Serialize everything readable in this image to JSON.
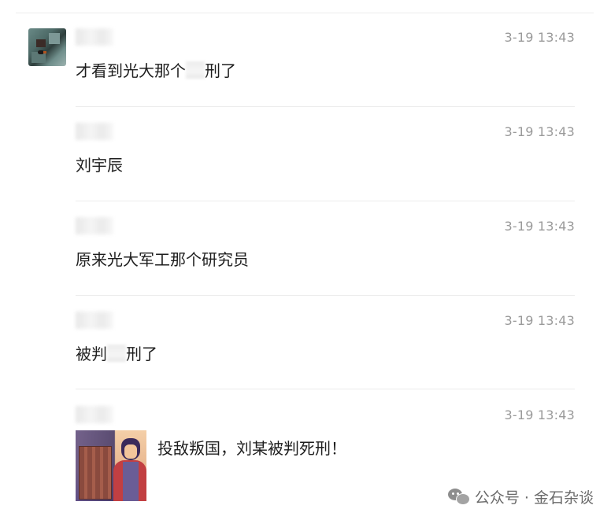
{
  "messages": [
    {
      "time": "3-19 13:43",
      "text_before": "才看到光大那个",
      "text_after": "刑了"
    },
    {
      "time": "3-19 13:43",
      "text": "刘宇辰"
    },
    {
      "time": "3-19 13:43",
      "text": "原来光大军工那个研究员"
    },
    {
      "time": "3-19 13:43",
      "text_before": "被判",
      "text_after": "刑了"
    },
    {
      "time": "3-19 13:43",
      "share_title": "投敌叛国，刘某被判死刑！"
    }
  ],
  "watermark": {
    "text": "公众号 · 金石杂谈",
    "icon": "wechat-icon"
  }
}
